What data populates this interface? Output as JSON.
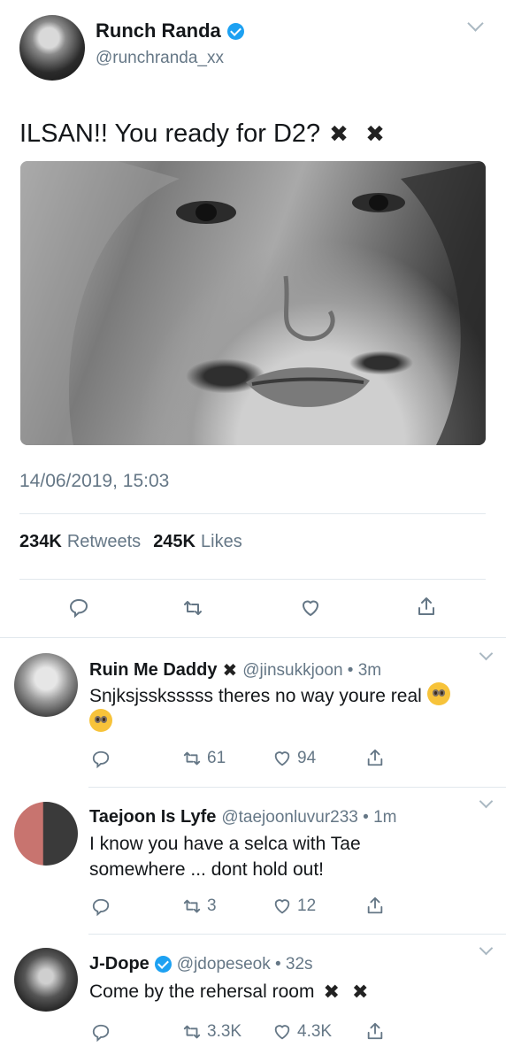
{
  "main_tweet": {
    "display_name": "Runch Randa",
    "handle": "@runchranda_xx",
    "text": "ILSAN!! You ready for D2?",
    "text_suffix": "✖ ✖",
    "timestamp": "14/06/2019, 15:03",
    "retweets_count": "234K",
    "retweets_label": "Retweets",
    "likes_count": "245K",
    "likes_label": "Likes"
  },
  "replies": [
    {
      "display_name": "Ruin Me Daddy",
      "name_suffix": "✖",
      "handle_time": "@jinsukkjoon • 3m",
      "text": "Snjksjssksssss theres no way youre real",
      "retweets": "61",
      "likes": "94"
    },
    {
      "display_name": "Taejoon Is Lyfe",
      "handle_time": "@taejoonluvur233 • 1m",
      "text": "I know you have a selca with Tae somewhere ... dont hold out!",
      "retweets": "3",
      "likes": "12"
    },
    {
      "display_name": "J-Dope",
      "handle_time": "@jdopeseok • 32s",
      "text": "Come by the rehersal room",
      "text_suffix": "✖ ✖",
      "retweets": "3.3K",
      "likes": "4.3K"
    }
  ],
  "colors": {
    "verified": "#1da1f2",
    "secondary_text": "#657786",
    "divider": "#e1e8ed"
  }
}
